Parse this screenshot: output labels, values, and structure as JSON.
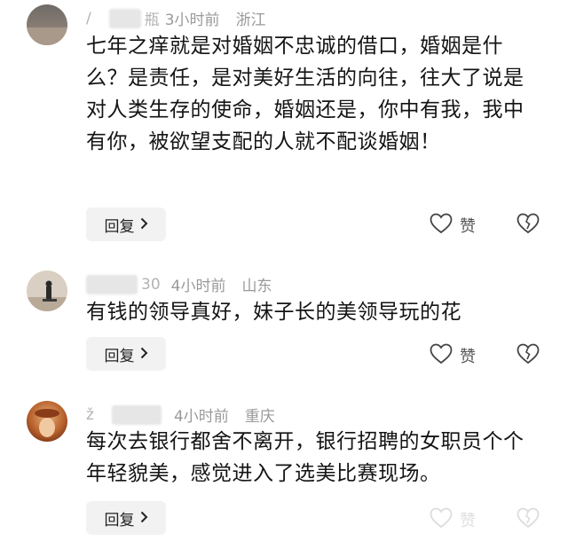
{
  "comments": [
    {
      "user_fragment": "瓶",
      "time": "3小时前",
      "location": "浙江",
      "text": "七年之痒就是对婚姻不忠诚的借口，婚姻是什么？是责任，是对美好生活的向往，往大了说是对人类生存的使命，婚姻还是，你中有我，我中有你，被欲望支配的人就不配谈婚姻！",
      "reply_label": "回复",
      "like_label": "赞"
    },
    {
      "user_fragment": "30",
      "time": "4小时前",
      "location": "山东",
      "text": "有钱的领导真好，妹子长的美领导玩的花",
      "reply_label": "回复",
      "like_label": "赞"
    },
    {
      "user_fragment": "",
      "time": "4小时前",
      "location": "重庆",
      "text": "每次去银行都舍不离开，银行招聘的女职员个个年轻貌美，感觉进入了选美比赛现场。",
      "reply_label": "回复",
      "like_label": "赞"
    }
  ],
  "icons": {
    "reply_chevron": "chevron-right-icon",
    "like": "heart-icon",
    "dislike": "broken-heart-icon"
  },
  "colors": {
    "meta_text": "#9a9a9a",
    "reply_bg": "#f2f2f2"
  }
}
